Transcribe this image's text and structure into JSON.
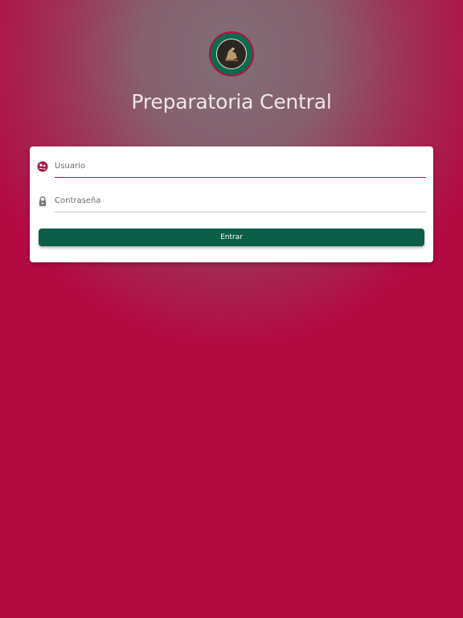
{
  "app": {
    "title": "Preparatoria Central"
  },
  "logo": {
    "icon": "school-seal-icon"
  },
  "form": {
    "username": {
      "placeholder": "Usuario",
      "value": "",
      "icon": "user-badge-icon"
    },
    "password": {
      "placeholder": "Contraseña",
      "value": "",
      "icon": "lock-icon"
    },
    "submit_label": "Entrar"
  },
  "colors": {
    "background": "#b30a42",
    "accent": "#a8174a",
    "button": "#0b5e48",
    "card": "#ffffff"
  }
}
